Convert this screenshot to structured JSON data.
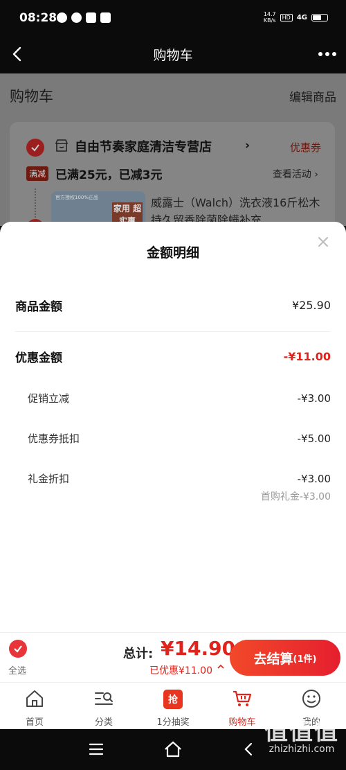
{
  "status_bar": {
    "time": "08:28",
    "net_speed_value": "14.7",
    "net_speed_unit": "KB/s",
    "hd": "HD",
    "network": "4G"
  },
  "header": {
    "title": "购物车"
  },
  "cart": {
    "title": "购物车",
    "edit_label": "编辑商品",
    "store": {
      "name": "自由节奏家庭清洁专营店",
      "coupon_label": "优惠券",
      "promo_tag": "满减",
      "promo_text": "已满25元，已减3元",
      "view_activity": "查看活动",
      "product_title": "威露士（Walch）洗衣液16斤松木持久留香除菌除螨补充…",
      "product_ribbon": "官方授权100%正品",
      "product_badge": "家用 超实惠"
    }
  },
  "sheet": {
    "title": "金额明细",
    "goods_amount_label": "商品金额",
    "goods_amount_value": "¥25.90",
    "discount_label": "优惠金额",
    "discount_value": "-¥11.00",
    "items": [
      {
        "label": "促销立减",
        "value": "-¥3.00"
      },
      {
        "label": "优惠券抵扣",
        "value": "-¥5.00"
      },
      {
        "label": "礼金折扣",
        "value": "-¥3.00",
        "note": "首购礼金-¥3.00"
      }
    ]
  },
  "checkout": {
    "select_all": "全选",
    "total_label": "总计:",
    "total_value": "¥14.90",
    "saved": "已优惠¥11.00",
    "button_label": "去结算",
    "button_count": "(1件)"
  },
  "tabs": [
    {
      "label": "首页",
      "icon": "home-icon"
    },
    {
      "label": "分类",
      "icon": "category-search-icon"
    },
    {
      "label": "1分抽奖",
      "icon": "lottery-icon",
      "icon_text": "抢"
    },
    {
      "label": "购物车",
      "icon": "cart-icon",
      "active": true
    },
    {
      "label": "我的",
      "icon": "smile-icon"
    }
  ],
  "watermark": {
    "text": "值值值",
    "domain": "zhizhizhi.com"
  },
  "colors": {
    "accent": "#e0241b",
    "dark": "#0b0b0b"
  }
}
